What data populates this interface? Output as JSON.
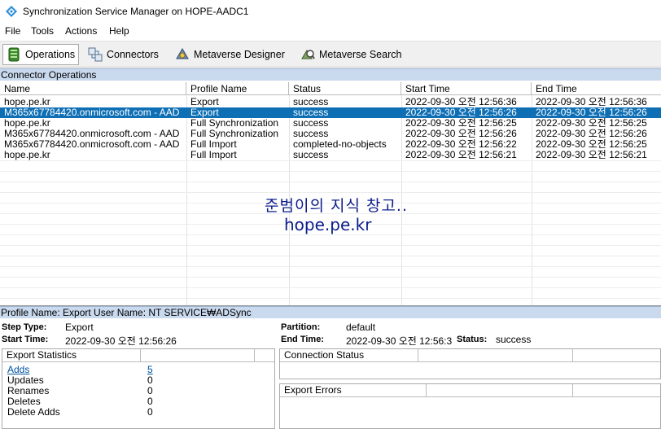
{
  "window": {
    "title": "Synchronization Service Manager on HOPE-AADC1"
  },
  "menu": [
    "File",
    "Tools",
    "Actions",
    "Help"
  ],
  "toolbar": {
    "operations": "Operations",
    "connectors": "Connectors",
    "metaverse_designer": "Metaverse Designer",
    "metaverse_search": "Metaverse Search"
  },
  "connector_operations": {
    "header": "Connector Operations",
    "columns": [
      "Name",
      "Profile Name",
      "Status",
      "Start Time",
      "End Time"
    ],
    "rows": [
      [
        "hope.pe.kr",
        "Export",
        "success",
        "2022-09-30 오전 12:56:36",
        "2022-09-30 오전 12:56:36"
      ],
      [
        "M365x67784420.onmicrosoft.com - AAD",
        "Export",
        "success",
        "2022-09-30 오전 12:56:26",
        "2022-09-30 오전 12:56:26"
      ],
      [
        "hope.pe.kr",
        "Full Synchronization",
        "success",
        "2022-09-30 오전 12:56:25",
        "2022-09-30 오전 12:56:25"
      ],
      [
        "M365x67784420.onmicrosoft.com - AAD",
        "Full Synchronization",
        "success",
        "2022-09-30 오전 12:56:26",
        "2022-09-30 오전 12:56:26"
      ],
      [
        "M365x67784420.onmicrosoft.com - AAD",
        "Full Import",
        "completed-no-objects",
        "2022-09-30 오전 12:56:22",
        "2022-09-30 오전 12:56:25"
      ],
      [
        "hope.pe.kr",
        "Full Import",
        "success",
        "2022-09-30 오전 12:56:21",
        "2022-09-30 오전 12:56:21"
      ]
    ],
    "selected_index": 1
  },
  "watermark": {
    "line1": "준범이의 지식 창고..",
    "line2": "hope.pe.kr"
  },
  "details": {
    "header": "Profile Name: Export  User Name: NT SERVICE₩ADSync",
    "step_type_label": "Step Type:",
    "step_type": "Export",
    "start_time_label": "Start Time:",
    "start_time": "2022-09-30 오전 12:56:26",
    "partition_label": "Partition:",
    "partition": "default",
    "end_time_label": "End Time:",
    "end_time": "2022-09-30 오전 12:56:3",
    "status_label": "Status:",
    "status": "success"
  },
  "export_statistics": {
    "header": "Export Statistics",
    "rows": [
      {
        "label": "Adds",
        "value": "5",
        "link": true
      },
      {
        "label": "Updates",
        "value": "0"
      },
      {
        "label": "Renames",
        "value": "0"
      },
      {
        "label": "Deletes",
        "value": "0"
      },
      {
        "label": "Delete Adds",
        "value": "0"
      }
    ]
  },
  "connection_status": {
    "header": "Connection Status"
  },
  "export_errors": {
    "header": "Export Errors"
  },
  "colors": {
    "selection": "#0e6fb5",
    "section_header": "#c9d9ee",
    "watermark": "#0b1c8a"
  },
  "icons": [
    "sync-app-icon",
    "operations-icon",
    "connectors-icon",
    "metaverse-designer-icon",
    "metaverse-search-icon"
  ]
}
